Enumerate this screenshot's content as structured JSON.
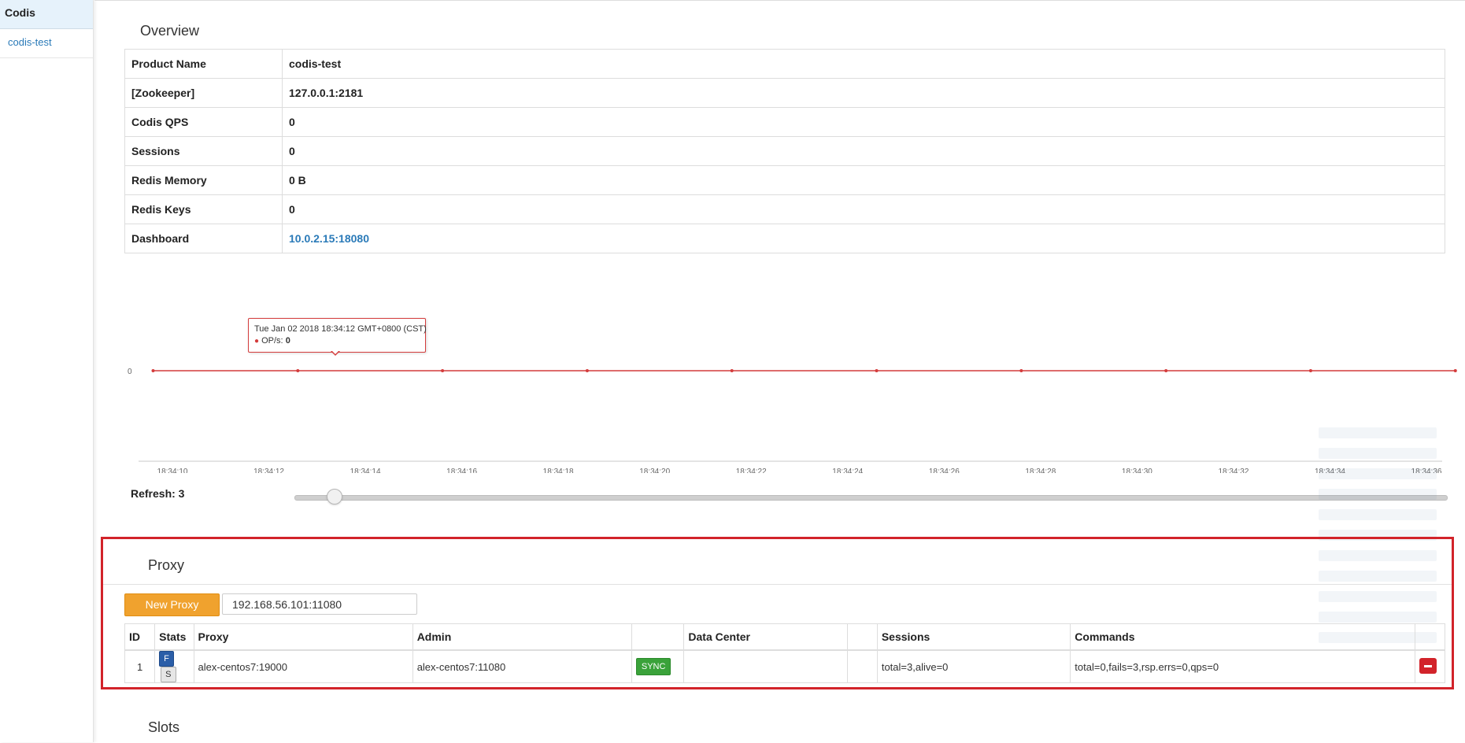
{
  "sidebar": {
    "header": "Codis",
    "items": [
      {
        "label": "codis-test"
      }
    ]
  },
  "overview": {
    "title": "Overview",
    "rows": [
      {
        "key": "Product Name",
        "value": "codis-test"
      },
      {
        "key": "[Zookeeper]",
        "value": "127.0.0.1:2181"
      },
      {
        "key": "Codis QPS",
        "value": "0"
      },
      {
        "key": "Sessions",
        "value": "0"
      },
      {
        "key": "Redis Memory",
        "value": "0 B"
      },
      {
        "key": "Redis Keys",
        "value": "0"
      },
      {
        "key": "Dashboard",
        "value": "10.0.2.15:18080",
        "link": true
      }
    ]
  },
  "chart_data": {
    "type": "line",
    "title": "",
    "xlabel": "",
    "ylabel": "",
    "x": [
      "18:34:09.6",
      "18:34:12.6",
      "18:34:15.6",
      "18:34:18.6",
      "18:34:21.6",
      "18:34:24.6",
      "18:34:27.6",
      "18:34:30.6",
      "18:34:33.6",
      "18:34:36.6"
    ],
    "series": [
      {
        "name": "OP/s",
        "values": [
          0,
          0,
          0,
          0,
          0,
          0,
          0,
          0,
          0,
          0
        ],
        "color": "#d43c3c"
      }
    ],
    "x_ticks": [
      "18:34:10",
      "18:34:12",
      "18:34:14",
      "18:34:16",
      "18:34:18",
      "18:34:20",
      "18:34:22",
      "18:34:24",
      "18:34:26",
      "18:34:28",
      "18:34:30",
      "18:34:32",
      "18:34:34",
      "18:34:36"
    ],
    "y_ticks": [
      "0"
    ],
    "grid": false
  },
  "tooltip": {
    "line1": "Tue Jan 02 2018 18:34:12 GMT+0800 (CST)",
    "series_label": "OP/s:",
    "value": "0"
  },
  "refresh": {
    "label": "Refresh: 3",
    "value": 3
  },
  "proxy": {
    "title": "Proxy",
    "new_button": "New Proxy",
    "input_value": "192.168.56.101:11080",
    "columns": [
      "ID",
      "Stats",
      "Proxy",
      "Admin",
      "",
      "Data Center",
      "",
      "Sessions",
      "Commands",
      ""
    ],
    "rows": [
      {
        "id": "1",
        "stats_f": "F",
        "stats_s": "S",
        "proxy": "alex-centos7:19000",
        "admin": "alex-centos7:11080",
        "sync": "SYNC",
        "data_center": "",
        "sessions": "total=3,alive=0",
        "commands": "total=0,fails=3,rsp.errs=0,qps=0"
      }
    ]
  },
  "slots": {
    "title": "Slots"
  },
  "colors": {
    "accent": "#2a7ab8",
    "highlight_border": "#d2232a",
    "line": "#d43c3c",
    "new_proxy": "#f0a22e",
    "sync": "#3aa23a"
  }
}
